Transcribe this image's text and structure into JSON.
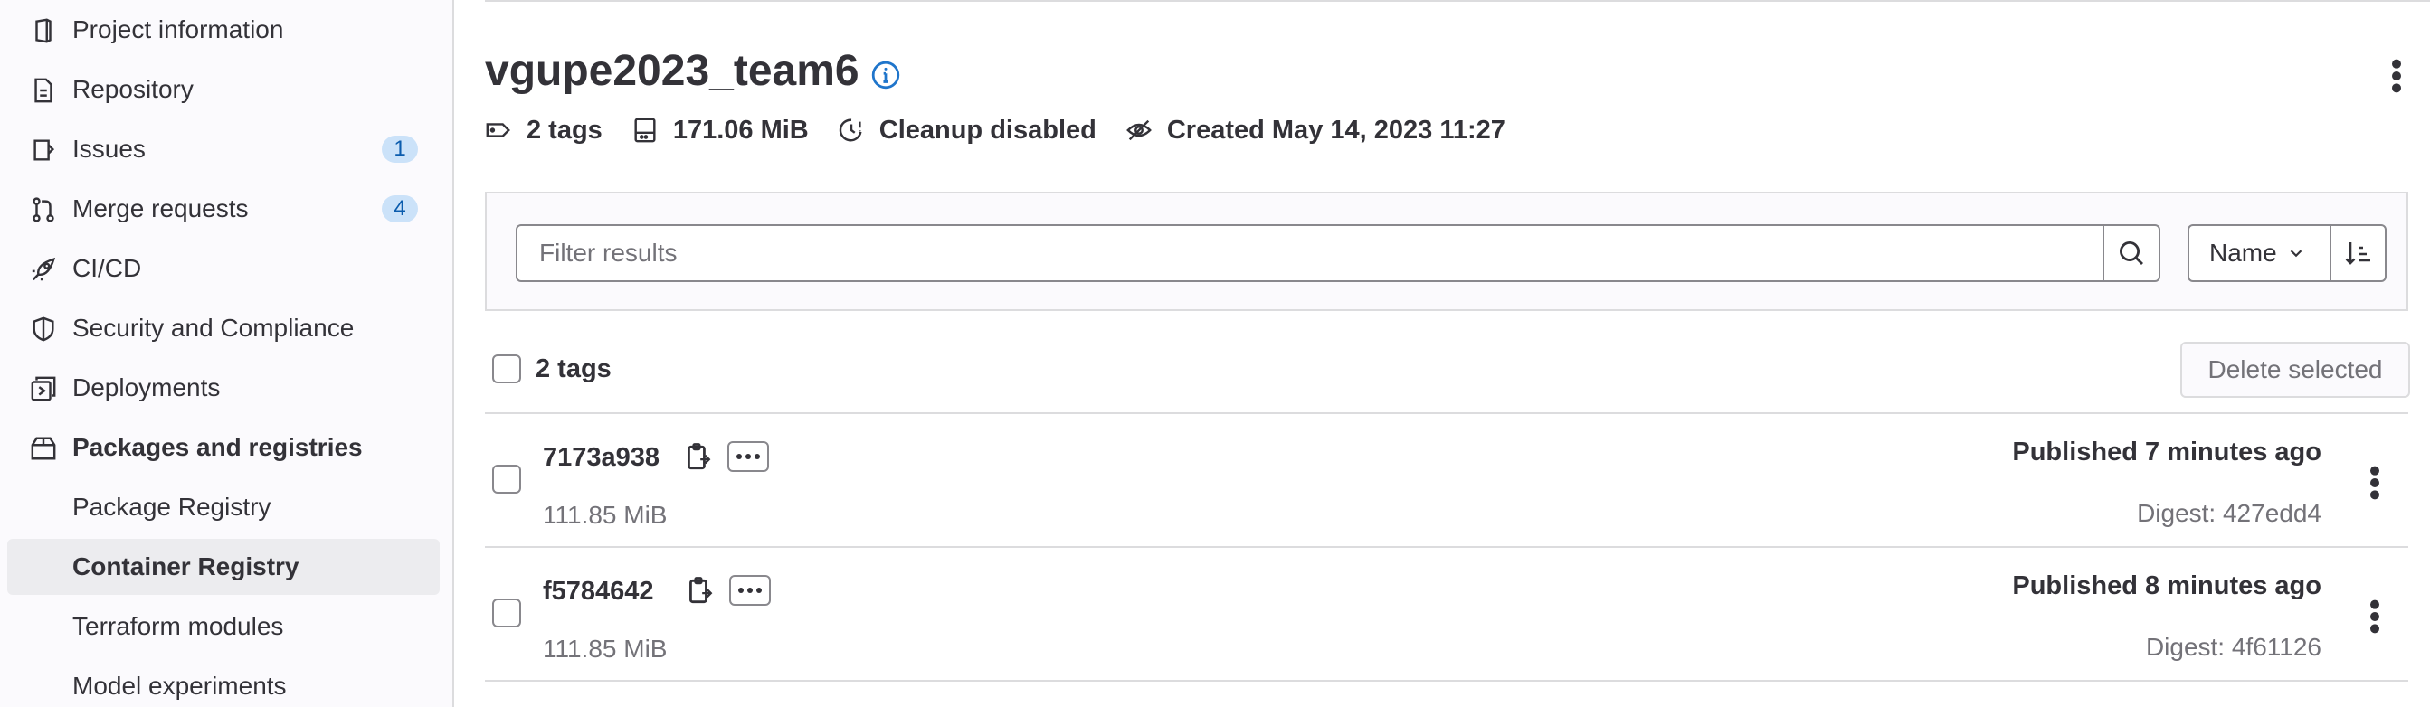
{
  "sidebar": {
    "items": [
      {
        "label": "Project information",
        "icon": "project-icon"
      },
      {
        "label": "Repository",
        "icon": "document-icon"
      },
      {
        "label": "Issues",
        "icon": "issues-icon",
        "badge": "1"
      },
      {
        "label": "Merge requests",
        "icon": "merge-request-icon",
        "badge": "4"
      },
      {
        "label": "CI/CD",
        "icon": "rocket-icon"
      },
      {
        "label": "Security and Compliance",
        "icon": "shield-icon"
      },
      {
        "label": "Deployments",
        "icon": "deployments-icon"
      },
      {
        "label": "Packages and registries",
        "icon": "package-icon"
      }
    ],
    "subitems": [
      {
        "label": "Package Registry"
      },
      {
        "label": "Container Registry",
        "active": true
      },
      {
        "label": "Terraform modules"
      },
      {
        "label": "Model experiments"
      }
    ]
  },
  "header": {
    "title": "vgupe2023_team6",
    "meta": {
      "tags": "2 tags",
      "size": "171.06 MiB",
      "cleanup": "Cleanup disabled",
      "created": "Created May 14, 2023 11:27"
    }
  },
  "filter": {
    "placeholder": "Filter results",
    "sort_label": "Name"
  },
  "list": {
    "count_label": "2 tags",
    "delete_label": "Delete selected",
    "rows": [
      {
        "tag": "7173a938",
        "size": "111.85 MiB",
        "published": "Published 7 minutes ago",
        "digest": "Digest: 427edd4"
      },
      {
        "tag": "f5784642",
        "size": "111.85 MiB",
        "published": "Published 8 minutes ago",
        "digest": "Digest: 4f61126"
      }
    ]
  },
  "colors": {
    "text": "#333238",
    "muted": "#737278",
    "border": "#dcdcde",
    "badge_bg": "#cbe2f9",
    "badge_text": "#0b5cad",
    "info_blue": "#1f75cb"
  }
}
